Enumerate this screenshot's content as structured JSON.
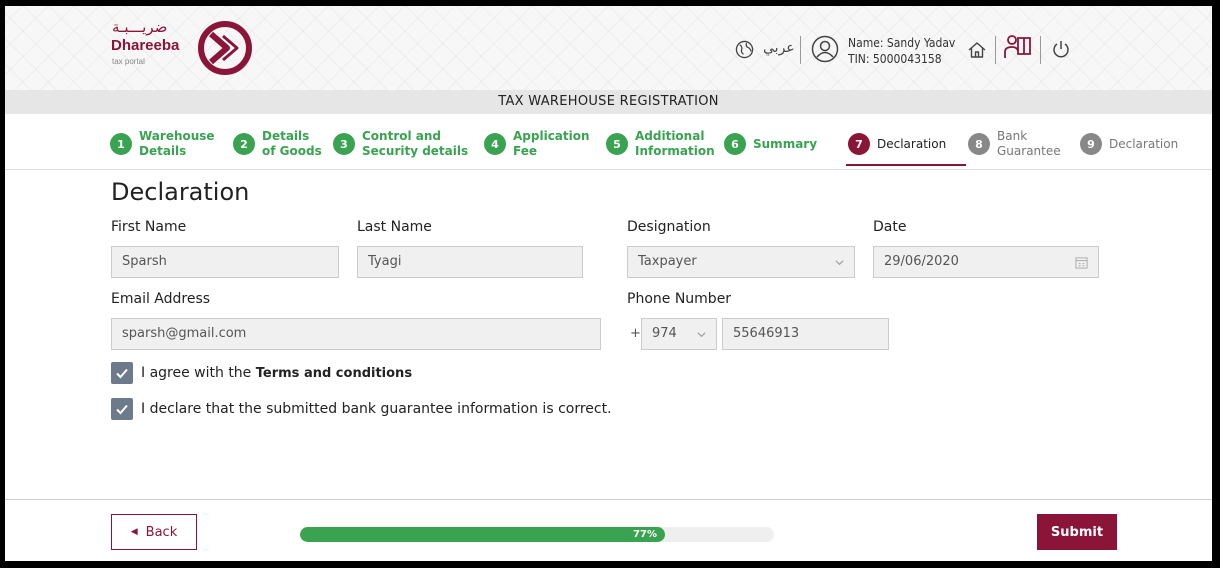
{
  "header": {
    "logo_arabic": "ضريـــبـة",
    "logo_name": "Dhareeba",
    "logo_tagline": "tax portal",
    "language_toggle": "عربي",
    "user_name": "Name: Sandy Yadav",
    "user_tin": "TIN: 5000043158"
  },
  "page_title": "TAX WAREHOUSE REGISTRATION",
  "steps": [
    {
      "num": "1",
      "line1": "Warehouse",
      "line2": "Details",
      "state": "done"
    },
    {
      "num": "2",
      "line1": "Details",
      "line2": "of Goods",
      "state": "done"
    },
    {
      "num": "3",
      "line1": "Control and",
      "line2": "Security details",
      "state": "done"
    },
    {
      "num": "4",
      "line1": "Application",
      "line2": "Fee",
      "state": "done"
    },
    {
      "num": "5",
      "line1": "Additional",
      "line2": "Information",
      "state": "done"
    },
    {
      "num": "6",
      "line1": "Summary",
      "line2": "",
      "state": "done"
    },
    {
      "num": "7",
      "line1": "Declaration",
      "line2": "",
      "state": "active"
    },
    {
      "num": "8",
      "line1": "Bank",
      "line2": "Guarantee",
      "state": "todo"
    },
    {
      "num": "9",
      "line1": "Declaration",
      "line2": "",
      "state": "todo"
    }
  ],
  "form": {
    "heading": "Declaration",
    "first_name_label": "First Name",
    "first_name_value": "Sparsh",
    "last_name_label": "Last Name",
    "last_name_value": "Tyagi",
    "designation_label": "Designation",
    "designation_value": "Taxpayer",
    "date_label": "Date",
    "date_value": "29/06/2020",
    "email_label": "Email Address",
    "email_value": "sparsh@gmail.com",
    "phone_label": "Phone Number",
    "phone_plus": "+",
    "phone_code": "974",
    "phone_value": "55646913",
    "terms_prefix": "I agree with the",
    "terms_link": "Terms and conditions",
    "terms_checked": true,
    "declare_text": "I declare that the submitted bank guarantee information is correct.",
    "declare_checked": true
  },
  "footer": {
    "back_label": "Back",
    "progress": 77,
    "progress_label": "77%",
    "submit_label": "Submit"
  },
  "colors": {
    "brand": "#8a1538",
    "done": "#3aa351",
    "checkbox": "#6c7a8c"
  }
}
